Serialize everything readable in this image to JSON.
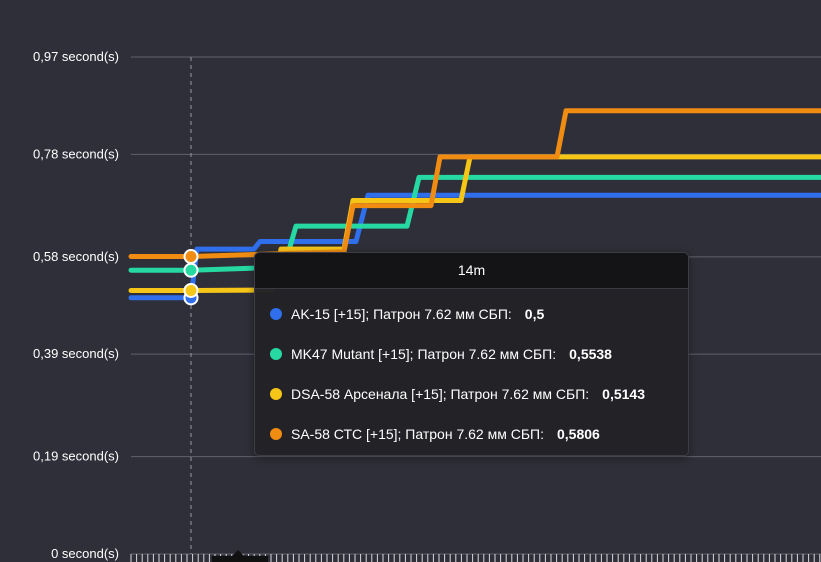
{
  "chart_data": {
    "type": "line",
    "step": true,
    "ylim": [
      0,
      0.97
    ],
    "yticks": [
      {
        "value": 0,
        "label": "0 second(s)"
      },
      {
        "value": 0.19,
        "label": "0,19 second(s)"
      },
      {
        "value": 0.39,
        "label": "0,39 second(s)"
      },
      {
        "value": 0.58,
        "label": "0,58 second(s)"
      },
      {
        "value": 0.78,
        "label": "0,78 second(s)"
      },
      {
        "value": 0.97,
        "label": "0,97 second(s)"
      }
    ],
    "xlim": [
      12,
      35
    ],
    "grid": true,
    "crosshair_x": 14,
    "series": [
      {
        "name": "AK-15 [+15]; Патрон 7.62 мм СБП:",
        "color": "#2f6fec",
        "points": [
          [
            12,
            0.5
          ],
          [
            14,
            0.5
          ],
          [
            14.2,
            0.595
          ],
          [
            16.1,
            0.595
          ],
          [
            16.3,
            0.61
          ],
          [
            19.5,
            0.61
          ],
          [
            19.9,
            0.7
          ],
          [
            35,
            0.7
          ]
        ]
      },
      {
        "name": "MK47 Mutant [+15]; Патрон 7.62 мм СБП:",
        "color": "#26d9a3",
        "points": [
          [
            12,
            0.5538
          ],
          [
            14,
            0.5538
          ],
          [
            17.1,
            0.56
          ],
          [
            17.5,
            0.64
          ],
          [
            21.2,
            0.64
          ],
          [
            21.6,
            0.735
          ],
          [
            35,
            0.735
          ]
        ]
      },
      {
        "name": "DSA-58 Арсенала [+15]; Патрон 7.62 мм СБП:",
        "color": "#f5c518",
        "points": [
          [
            12,
            0.5143
          ],
          [
            14,
            0.5143
          ],
          [
            16.7,
            0.515
          ],
          [
            17.0,
            0.595
          ],
          [
            19.1,
            0.595
          ],
          [
            19.4,
            0.69
          ],
          [
            23.0,
            0.69
          ],
          [
            23.3,
            0.775
          ],
          [
            35,
            0.775
          ]
        ]
      },
      {
        "name": "SA-58 СТС [+15]; Патрон 7.62 мм СБП:",
        "color": "#f08c12",
        "points": [
          [
            12,
            0.5806
          ],
          [
            14,
            0.5806
          ],
          [
            19.1,
            0.59
          ],
          [
            19.4,
            0.68
          ],
          [
            22.0,
            0.68
          ],
          [
            22.3,
            0.775
          ],
          [
            26.2,
            0.775
          ],
          [
            26.5,
            0.865
          ],
          [
            35,
            0.865
          ]
        ]
      }
    ]
  },
  "tooltip": {
    "title": "14m",
    "rows": [
      {
        "label": "AK-15 [+15]; Патрон 7.62 мм СБП:",
        "value": "0,5",
        "color": "#2f6fec"
      },
      {
        "label": "MK47 Mutant [+15]; Патрон 7.62 мм СБП:",
        "value": "0,5538",
        "color": "#26d9a3"
      },
      {
        "label": "DSA-58 Арсенала [+15]; Патрон 7.62 мм СБП:",
        "value": "0,5143",
        "color": "#f5c518"
      },
      {
        "label": "SA-58 СТС [+15]; Патрон 7.62 мм СБП:",
        "value": "0,5806",
        "color": "#f08c12"
      }
    ]
  },
  "colors": {
    "background": "#2f2f39",
    "grid": "#62626e",
    "crosshair": "#9a9aa6"
  }
}
